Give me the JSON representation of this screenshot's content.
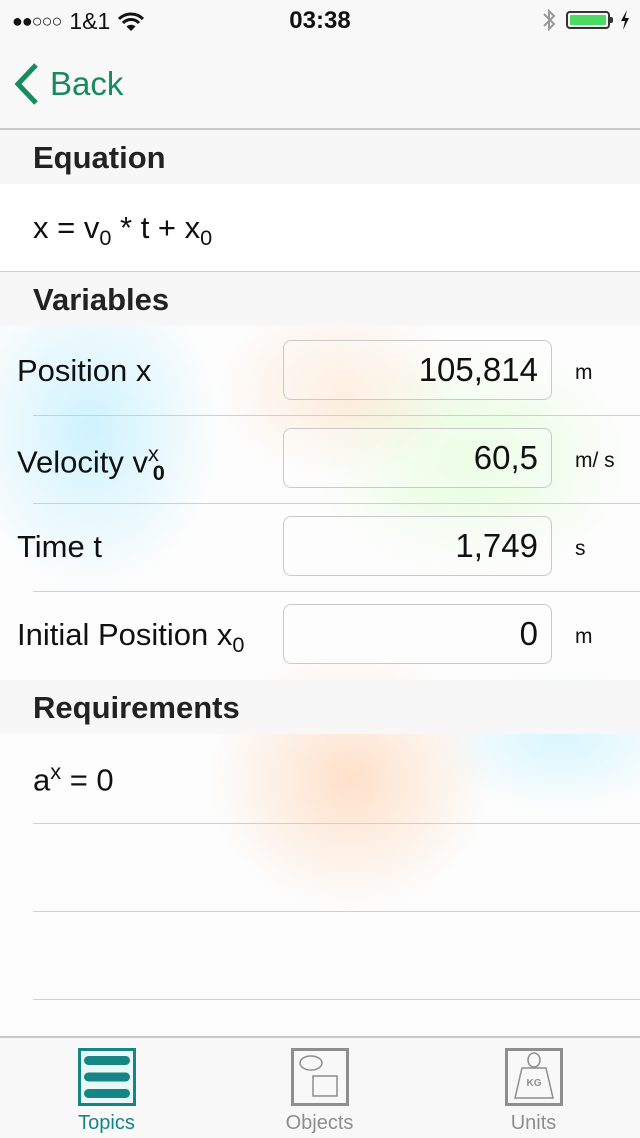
{
  "status_bar": {
    "signal": "●●○○○",
    "carrier": "1&1",
    "time": "03:38"
  },
  "nav": {
    "back_label": "Back"
  },
  "equation": {
    "header": "Equation",
    "parts": [
      "x = v",
      "0",
      " * t + x",
      "0"
    ]
  },
  "variables": {
    "header": "Variables",
    "items": [
      {
        "label": "Position x",
        "value": "105,814",
        "unit": "m"
      },
      {
        "label_main": "Velocity v",
        "label_sup": "x",
        "label_sub": "0",
        "value": "60,5",
        "unit": "m/ s"
      },
      {
        "label": "Time t",
        "value": "1,749",
        "unit": "s"
      },
      {
        "label_main": "Initial Position x",
        "label_sub": "0",
        "value": "0",
        "unit": "m"
      }
    ]
  },
  "requirements": {
    "header": "Requirements",
    "items": [
      {
        "main": "a",
        "sup": "x",
        "rest": " = 0"
      }
    ]
  },
  "tabs": [
    {
      "label": "Topics",
      "icon": "list-icon",
      "active": true
    },
    {
      "label": "Objects",
      "icon": "objects-icon",
      "active": false
    },
    {
      "label": "Units",
      "icon": "weight-kg-icon",
      "active": false,
      "icon_text": "KG"
    }
  ],
  "colors": {
    "accent": "#178a5e",
    "tab_active": "#178585",
    "battery": "#4cd964"
  }
}
